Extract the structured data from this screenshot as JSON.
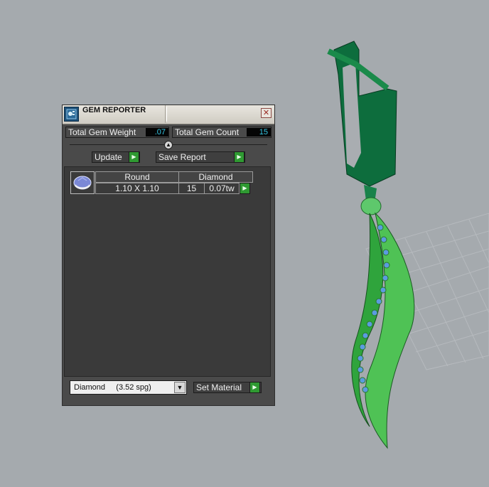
{
  "colors": {
    "background": "#a5aaae",
    "accent_green": "#2f9a32",
    "value_text": "#35c8e6"
  },
  "window": {
    "title": "GEM REPORTER",
    "app_icon": "gem-reporter-icon",
    "close_icon": "close-icon"
  },
  "stats": {
    "weight_label": "Total Gem Weight",
    "weight_value": ".07",
    "count_label": "Total Gem Count",
    "count_value": "15"
  },
  "actions": {
    "update_label": "Update",
    "save_label": "Save Report"
  },
  "gems": [
    {
      "shape": "Round",
      "size": "1.10 X 1.10",
      "material": "Diamond",
      "count": "15",
      "weight": "0.07tw",
      "icon": "round-gem-icon"
    }
  ],
  "footer": {
    "material_select": "Diamond     (3.52 spg)",
    "set_material_label": "Set Material"
  }
}
